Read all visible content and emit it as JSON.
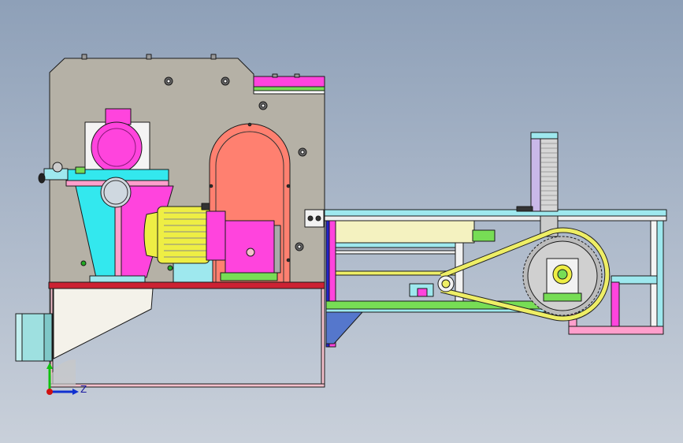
{
  "view": {
    "background_top": "#8ea0b8",
    "background_bottom": "#c9d0da",
    "edge_color": "#1a1a1a"
  },
  "triad": {
    "z_label": "Z",
    "x_axis_color": "#d01010",
    "y_axis_color": "#10c010",
    "z_axis_color": "#1030d0"
  },
  "parts": {
    "housing": "#b5b1a6",
    "motor_main": "#ff44dd",
    "hopper_left": "#33e8ee",
    "arch_guard": "#ff8070",
    "motor_yellow": "#eeee44",
    "gearbox": "#ff44dd",
    "base_plate": "#cc2233",
    "frame": "#f8d0d8",
    "duct": "#9ee0e0",
    "rail": "#9ee8ee",
    "belt": "#eeee66",
    "pulley": "#bbbbbb",
    "bracket_green": "#77dd55",
    "vertical_rack": "#c9b8e8"
  }
}
